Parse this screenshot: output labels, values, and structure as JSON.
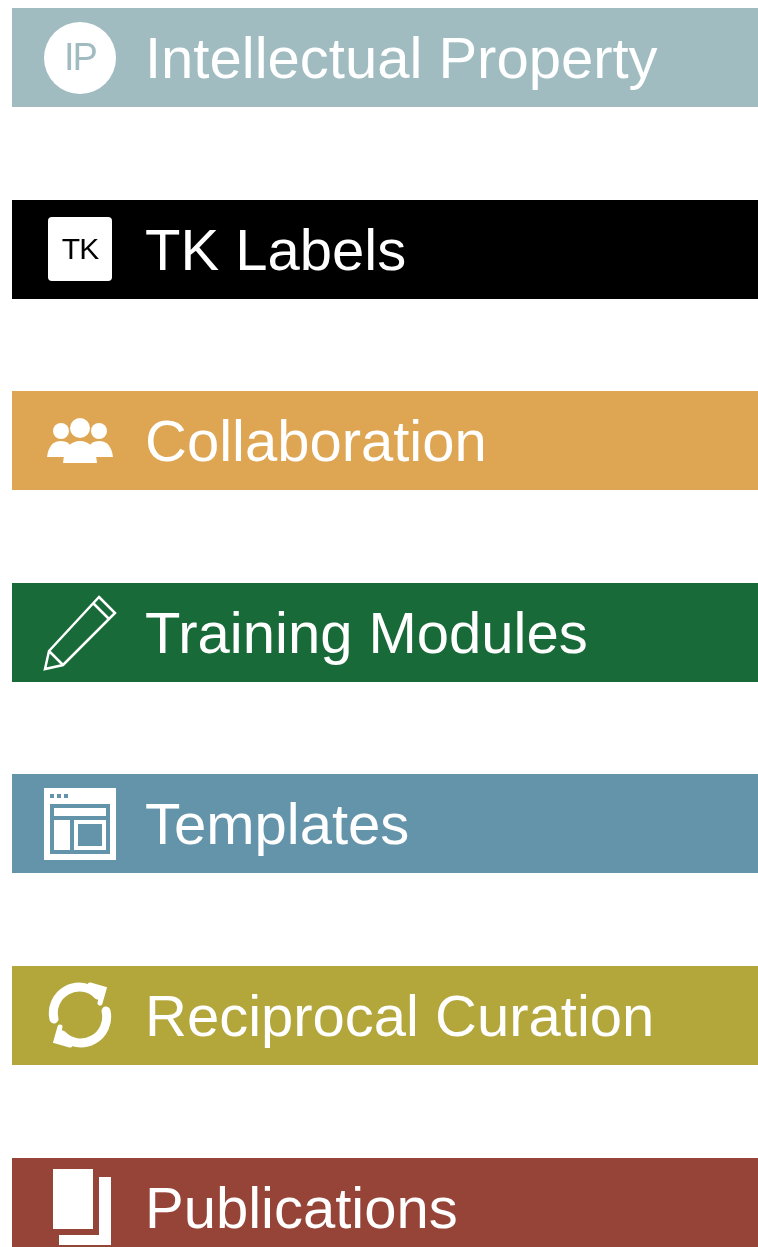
{
  "menu": [
    {
      "label": "Intellectual Property",
      "color": "#a0bcc0",
      "badge": "IP"
    },
    {
      "label": "TK Labels",
      "color": "#000000",
      "badge": "TK"
    },
    {
      "label": "Collaboration",
      "color": "#dea552"
    },
    {
      "label": "Training Modules",
      "color": "#186a38"
    },
    {
      "label": "Templates",
      "color": "#6494aa"
    },
    {
      "label": "Reciprocal Curation",
      "color": "#b3a63a"
    },
    {
      "label": "Publications",
      "color": "#974438"
    }
  ]
}
